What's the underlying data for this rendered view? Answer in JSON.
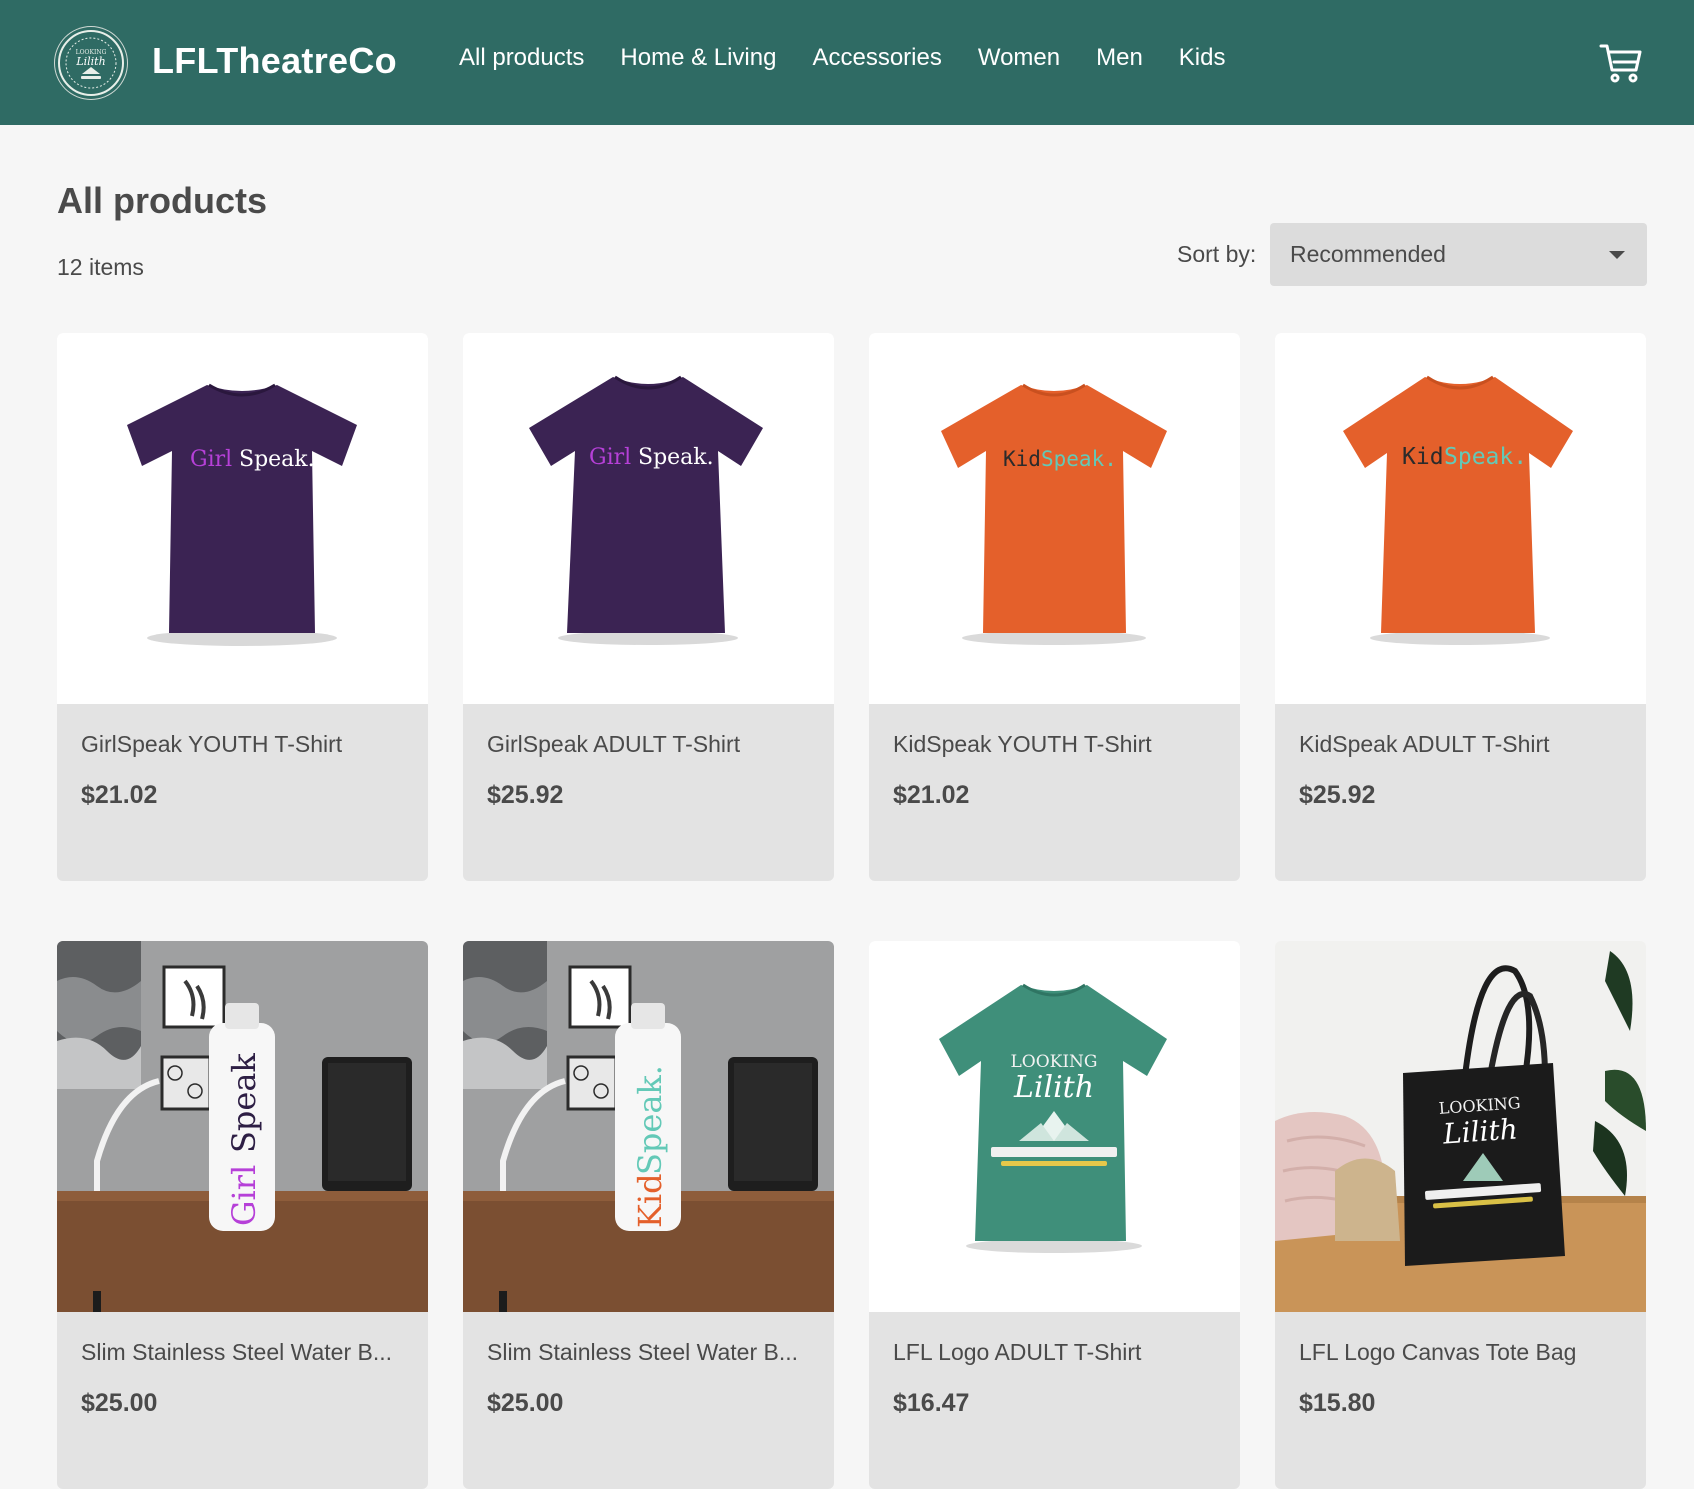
{
  "header": {
    "brand": "LFLTheatreCo",
    "logo_icon": "lfl-theatre-seal-logo",
    "cart_icon": "shopping-cart-icon",
    "nav": [
      "All products",
      "Home & Living",
      "Accessories",
      "Women",
      "Men",
      "Kids"
    ]
  },
  "main": {
    "title": "All products",
    "count": "12 items",
    "sort_label": "Sort by:",
    "sort_value": "Recommended"
  },
  "products": [
    {
      "name": "GirlSpeak YOUTH T-Shirt",
      "price": "$21.02",
      "print_a": "Girl",
      "print_b": "Speak."
    },
    {
      "name": "GirlSpeak ADULT T-Shirt",
      "price": "$25.92",
      "print_a": "Girl",
      "print_b": "Speak."
    },
    {
      "name": "KidSpeak YOUTH T-Shirt",
      "price": "$21.02",
      "print_a": "Kid",
      "print_b": "Speak."
    },
    {
      "name": "KidSpeak ADULT T-Shirt",
      "price": "$25.92",
      "print_a": "Kid",
      "print_b": "Speak."
    },
    {
      "name": "Slim Stainless Steel Water B...",
      "price": "$25.00",
      "print_a": "Girl",
      "print_b": "Speak"
    },
    {
      "name": "Slim Stainless Steel Water B...",
      "price": "$25.00",
      "print_a": "Kid",
      "print_b": "Speak."
    },
    {
      "name": "LFL Logo ADULT T-Shirt",
      "price": "$16.47",
      "print_a": "LOOKING",
      "print_b": "Lilith"
    },
    {
      "name": "LFL Logo Canvas Tote Bag",
      "price": "$15.80",
      "print_a": "LOOKING",
      "print_b": "Lilith"
    }
  ],
  "colors": {
    "header": "#2f6b64",
    "purple_shirt": "#3b2353",
    "orange_shirt": "#e4602b",
    "green_shirt": "#3f8f7a",
    "girl_accent": "#b640d8",
    "kid_accent": "#63c9b7"
  }
}
